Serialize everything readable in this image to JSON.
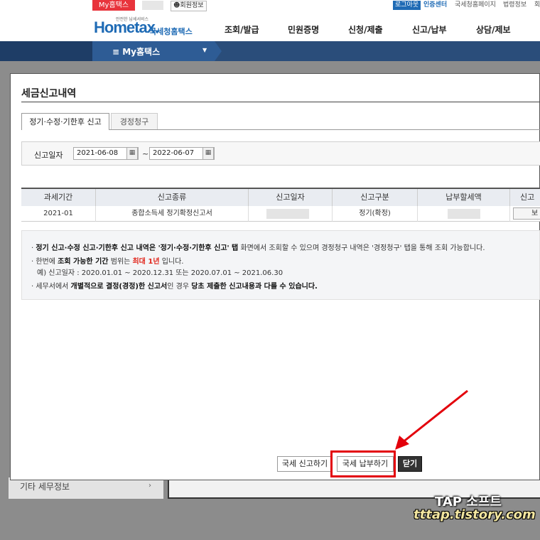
{
  "topbar": {
    "my_hometax": "My홈택스",
    "member_info": "회원정보",
    "logout": "로그아웃",
    "cert_center": "인증센터",
    "links": [
      "국세청홈페이지",
      "법령정보",
      "회"
    ]
  },
  "header": {
    "logo_tagline": "안전한 납세서비스",
    "logo_main": "Hometax.",
    "logo_sub": "국세청홈택스",
    "menu": [
      "조회/발급",
      "민원증명",
      "신청/제출",
      "신고/납부",
      "상담/제보"
    ]
  },
  "navbar": {
    "label": "My홈택스"
  },
  "background": {
    "side_item": "기타 세무정보"
  },
  "modal": {
    "title": "세금신고내역",
    "tabs": [
      "정기·수정·기한후 신고",
      "경정청구"
    ],
    "search": {
      "label": "신고일자",
      "date_from": "2021-06-08",
      "date_to": "2022-06-07",
      "separator": "~"
    },
    "table": {
      "headers": [
        "과세기간",
        "신고종류",
        "신고일자",
        "신고구분",
        "납부할세액",
        "신고서"
      ],
      "rows": [
        {
          "period": "2021-01",
          "type": "종합소득세 정기확정신고서",
          "date": "",
          "category": "정기(확정)",
          "tax": "",
          "action": "보"
        }
      ]
    },
    "notes": {
      "n1_a": "정기 신고·수정 신고·기한후 신고 내역은 ",
      "n1_b": "'정기·수정·기한후 신고' 탭",
      "n1_c": " 화면에서 조회할 수 있으며 경정청구 내역은 '경정청구' 탭을 통해 조회 가능합니다.",
      "n2_a": "한번에 ",
      "n2_b": "조회 가능한 기간",
      "n2_c": " 범위는 ",
      "n2_d": "최대 1년",
      "n2_e": " 입니다.",
      "n2_example": "예) 신고일자 : 2020.01.01 ~ 2020.12.31 또는 2020.07.01 ~ 2021.06.30",
      "n3_a": "세무서에서 ",
      "n3_b": "개별적으로 결정(경정)한 신고서",
      "n3_c": "인 경우 ",
      "n3_d": "당초 제출한 신고내용과 다를 수 있습니다."
    },
    "buttons": {
      "file_tax": "국세 신고하기",
      "pay_tax": "국세 납부하기",
      "close": "닫기"
    }
  },
  "watermark": {
    "line1": "TAP 소프트",
    "line2": "tttap.tistory.com"
  },
  "colors": {
    "accent_red": "#e3000b",
    "nav_blue": "#2a4d7a",
    "brand_blue": "#1f6bb5"
  }
}
